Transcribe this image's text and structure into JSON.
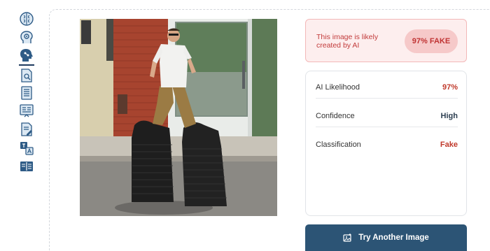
{
  "sidebar": {
    "items": [
      {
        "icon": "brain-icon"
      },
      {
        "icon": "head-gear-icon"
      },
      {
        "icon": "ai-head-icon",
        "active": true
      },
      {
        "icon": "document-search-icon"
      },
      {
        "icon": "document-list-icon"
      },
      {
        "icon": "image-grid-icon"
      },
      {
        "icon": "document-edit-icon"
      },
      {
        "icon": "translate-icon"
      },
      {
        "icon": "book-icon"
      }
    ]
  },
  "result": {
    "verdict_text": "This image is likely created by AI",
    "badge": "97% FAKE",
    "stats": [
      {
        "label": "AI Likelihood",
        "value": "97%"
      },
      {
        "label": "Confidence",
        "value": "High"
      },
      {
        "label": "Classification",
        "value": "Fake"
      }
    ]
  },
  "actions": {
    "try_again_label": "Try Another Image"
  },
  "colors": {
    "accent": "#2c5475",
    "danger": "#c0392b",
    "danger_bg": "#fdeeee",
    "sidebar_icon": "#2e5b86"
  }
}
